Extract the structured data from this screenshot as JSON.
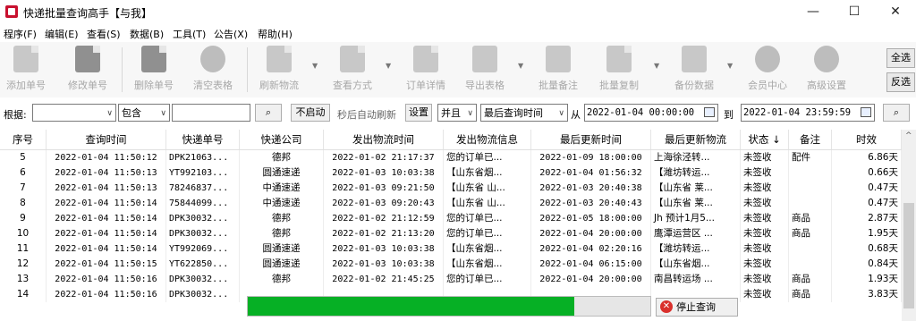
{
  "window": {
    "title": "快递批量查询高手【与我】",
    "minimize": "—",
    "maximize": "☐",
    "close": "✕"
  },
  "menu": [
    "程序(F)",
    "编辑(E)",
    "查看(S)",
    "数据(B)",
    "工具(T)",
    "公告(X)",
    "帮助(H)"
  ],
  "toolbar": {
    "add": "添加单号",
    "edit": "修改单号",
    "delete": "删除单号",
    "clear": "清空表格",
    "refresh": "刷新物流",
    "view_mode": "查看方式",
    "order_detail": "订单详情",
    "export": "导出表格",
    "batch_note": "批量备注",
    "batch_copy": "批量复制",
    "backup": "备份数据",
    "member": "会员中心",
    "advanced": "高级设置",
    "select_all": "全选",
    "invert": "反选"
  },
  "filter": {
    "by_label": "根据:",
    "by_value": "",
    "op_value": "包含",
    "keyword": "",
    "no_auto": "不启动",
    "auto_hint": "秒后自动刷新",
    "settings": "设置",
    "and_value": "并且",
    "time_field": "最后查询时间",
    "from_label": "从",
    "from_dt": "2022-01-04 00:00:00",
    "to_label": "到",
    "to_dt": "2022-01-04 23:59:59"
  },
  "table": {
    "headers": [
      "序号",
      "查询时间",
      "快递单号",
      "快递公司",
      "发出物流时间",
      "发出物流信息",
      "最后更新时间",
      "最后更新物流",
      "状态 ↓",
      "备注",
      "时效"
    ],
    "rows": [
      [
        "5",
        "2022-01-04 11:50:12",
        "DPK21063...",
        "德邦",
        "2022-01-02 21:17:37",
        "您的订单已...",
        "2022-01-09 18:00:00",
        "上海徐泾转...",
        "未签收",
        "配件",
        "6.86天"
      ],
      [
        "6",
        "2022-01-04 11:50:13",
        "YT992103...",
        "圆通速递",
        "2022-01-03 10:03:38",
        "【山东省烟...",
        "2022-01-04 01:56:32",
        "【潍坊转运...",
        "未签收",
        "",
        "0.66天"
      ],
      [
        "7",
        "2022-01-04 11:50:13",
        "78246837...",
        "中通速递",
        "2022-01-03 09:21:50",
        "【山东省 山...",
        "2022-01-03 20:40:38",
        "【山东省 莱...",
        "未签收",
        "",
        "0.47天"
      ],
      [
        "8",
        "2022-01-04 11:50:14",
        "75844099...",
        "中通速递",
        "2022-01-03 09:20:43",
        "【山东省 山...",
        "2022-01-03 20:40:43",
        "【山东省 莱...",
        "未签收",
        "",
        "0.47天"
      ],
      [
        "9",
        "2022-01-04 11:50:14",
        "DPK30032...",
        "德邦",
        "2022-01-02 21:12:59",
        "您的订单已...",
        "2022-01-05 18:00:00",
        "Jh 预计1月5...",
        "未签收",
        "商品",
        "2.87天"
      ],
      [
        "10",
        "2022-01-04 11:50:14",
        "DPK30032...",
        "德邦",
        "2022-01-02 21:13:20",
        "您的订单已...",
        "2022-01-04 20:00:00",
        "鹰潭运营区 ...",
        "未签收",
        "商品",
        "1.95天"
      ],
      [
        "11",
        "2022-01-04 11:50:14",
        "YT992069...",
        "圆通速递",
        "2022-01-03 10:03:38",
        "【山东省烟...",
        "2022-01-04 02:20:16",
        "【潍坊转运...",
        "未签收",
        "",
        "0.68天"
      ],
      [
        "12",
        "2022-01-04 11:50:15",
        "YT622850...",
        "圆通速递",
        "2022-01-03 10:03:38",
        "【山东省烟...",
        "2022-01-04 06:15:00",
        "【山东省烟...",
        "未签收",
        "",
        "0.84天"
      ],
      [
        "13",
        "2022-01-04 11:50:16",
        "DPK30032...",
        "德邦",
        "2022-01-02 21:45:25",
        "您的订单已...",
        "2022-01-04 20:00:00",
        "南昌转运场 ...",
        "未签收",
        "商品",
        "1.93天"
      ],
      [
        "14",
        "2022-01-04 11:50:16",
        "DPK30032...",
        "",
        "",
        "",
        "",
        "",
        "未签收",
        "商品",
        "3.83天"
      ]
    ]
  },
  "progress": {
    "fraction": 0.81,
    "color": "#06b025"
  },
  "stop_button": "停止查询"
}
